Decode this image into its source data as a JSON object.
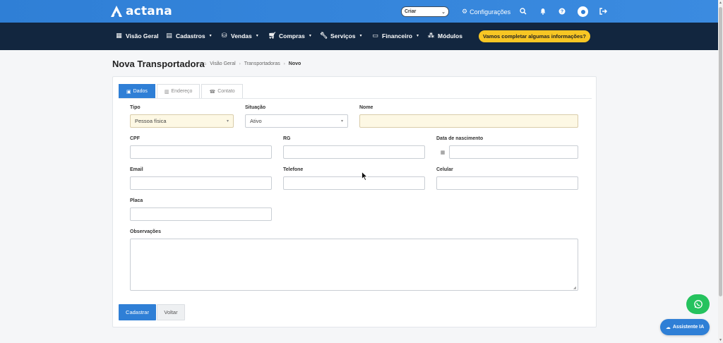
{
  "app": {
    "brand": "actana"
  },
  "topbar": {
    "create_select": "Criar",
    "settings_label": "Configurações",
    "icons": [
      "search-icon",
      "bell-icon",
      "help-icon",
      "user-icon",
      "logout-icon"
    ]
  },
  "nav": {
    "items": [
      {
        "label": "Visão Geral",
        "icon": "grid-icon"
      },
      {
        "label": "Cadastros",
        "icon": "card-icon"
      },
      {
        "label": "Vendas",
        "icon": "bag-icon"
      },
      {
        "label": "Compras",
        "icon": "cart-icon"
      },
      {
        "label": "Serviços",
        "icon": "wrench-icon"
      },
      {
        "label": "Financeiro",
        "icon": "money-icon"
      },
      {
        "label": "Módulos",
        "icon": "cubes-icon"
      }
    ],
    "cta": "Vamos completar algumas informações?"
  },
  "page": {
    "title": "Nova Transportadora",
    "breadcrumb": [
      "Visão Geral",
      "Transportadoras",
      "Novo"
    ]
  },
  "tabs": [
    {
      "label": "Dados",
      "icon": "id-card-icon",
      "active": true
    },
    {
      "label": "Endereço",
      "icon": "building-icon",
      "active": false
    },
    {
      "label": "Contato",
      "icon": "phone-icon",
      "active": false
    }
  ],
  "form": {
    "tipo": {
      "label": "Tipo",
      "value": "Pessoa física"
    },
    "situacao": {
      "label": "Situação",
      "value": "Ativo"
    },
    "nome": {
      "label": "Nome",
      "value": ""
    },
    "cpf": {
      "label": "CPF",
      "value": ""
    },
    "rg": {
      "label": "RG",
      "value": ""
    },
    "nascimento": {
      "label": "Data de nascimento",
      "value": ""
    },
    "email": {
      "label": "Email",
      "value": ""
    },
    "telefone": {
      "label": "Telefone",
      "value": ""
    },
    "celular": {
      "label": "Celular",
      "value": ""
    },
    "placa": {
      "label": "Placa",
      "value": ""
    },
    "observacoes": {
      "label": "Observações",
      "value": ""
    }
  },
  "buttons": {
    "submit": "Cadastrar",
    "back": "Voltar"
  },
  "floating": {
    "assistant": "Assistente IA"
  },
  "colors": {
    "primary": "#2f7fd6",
    "nav_bg": "#12263f",
    "cta": "#f7c624",
    "whatsapp": "#25c25e"
  }
}
